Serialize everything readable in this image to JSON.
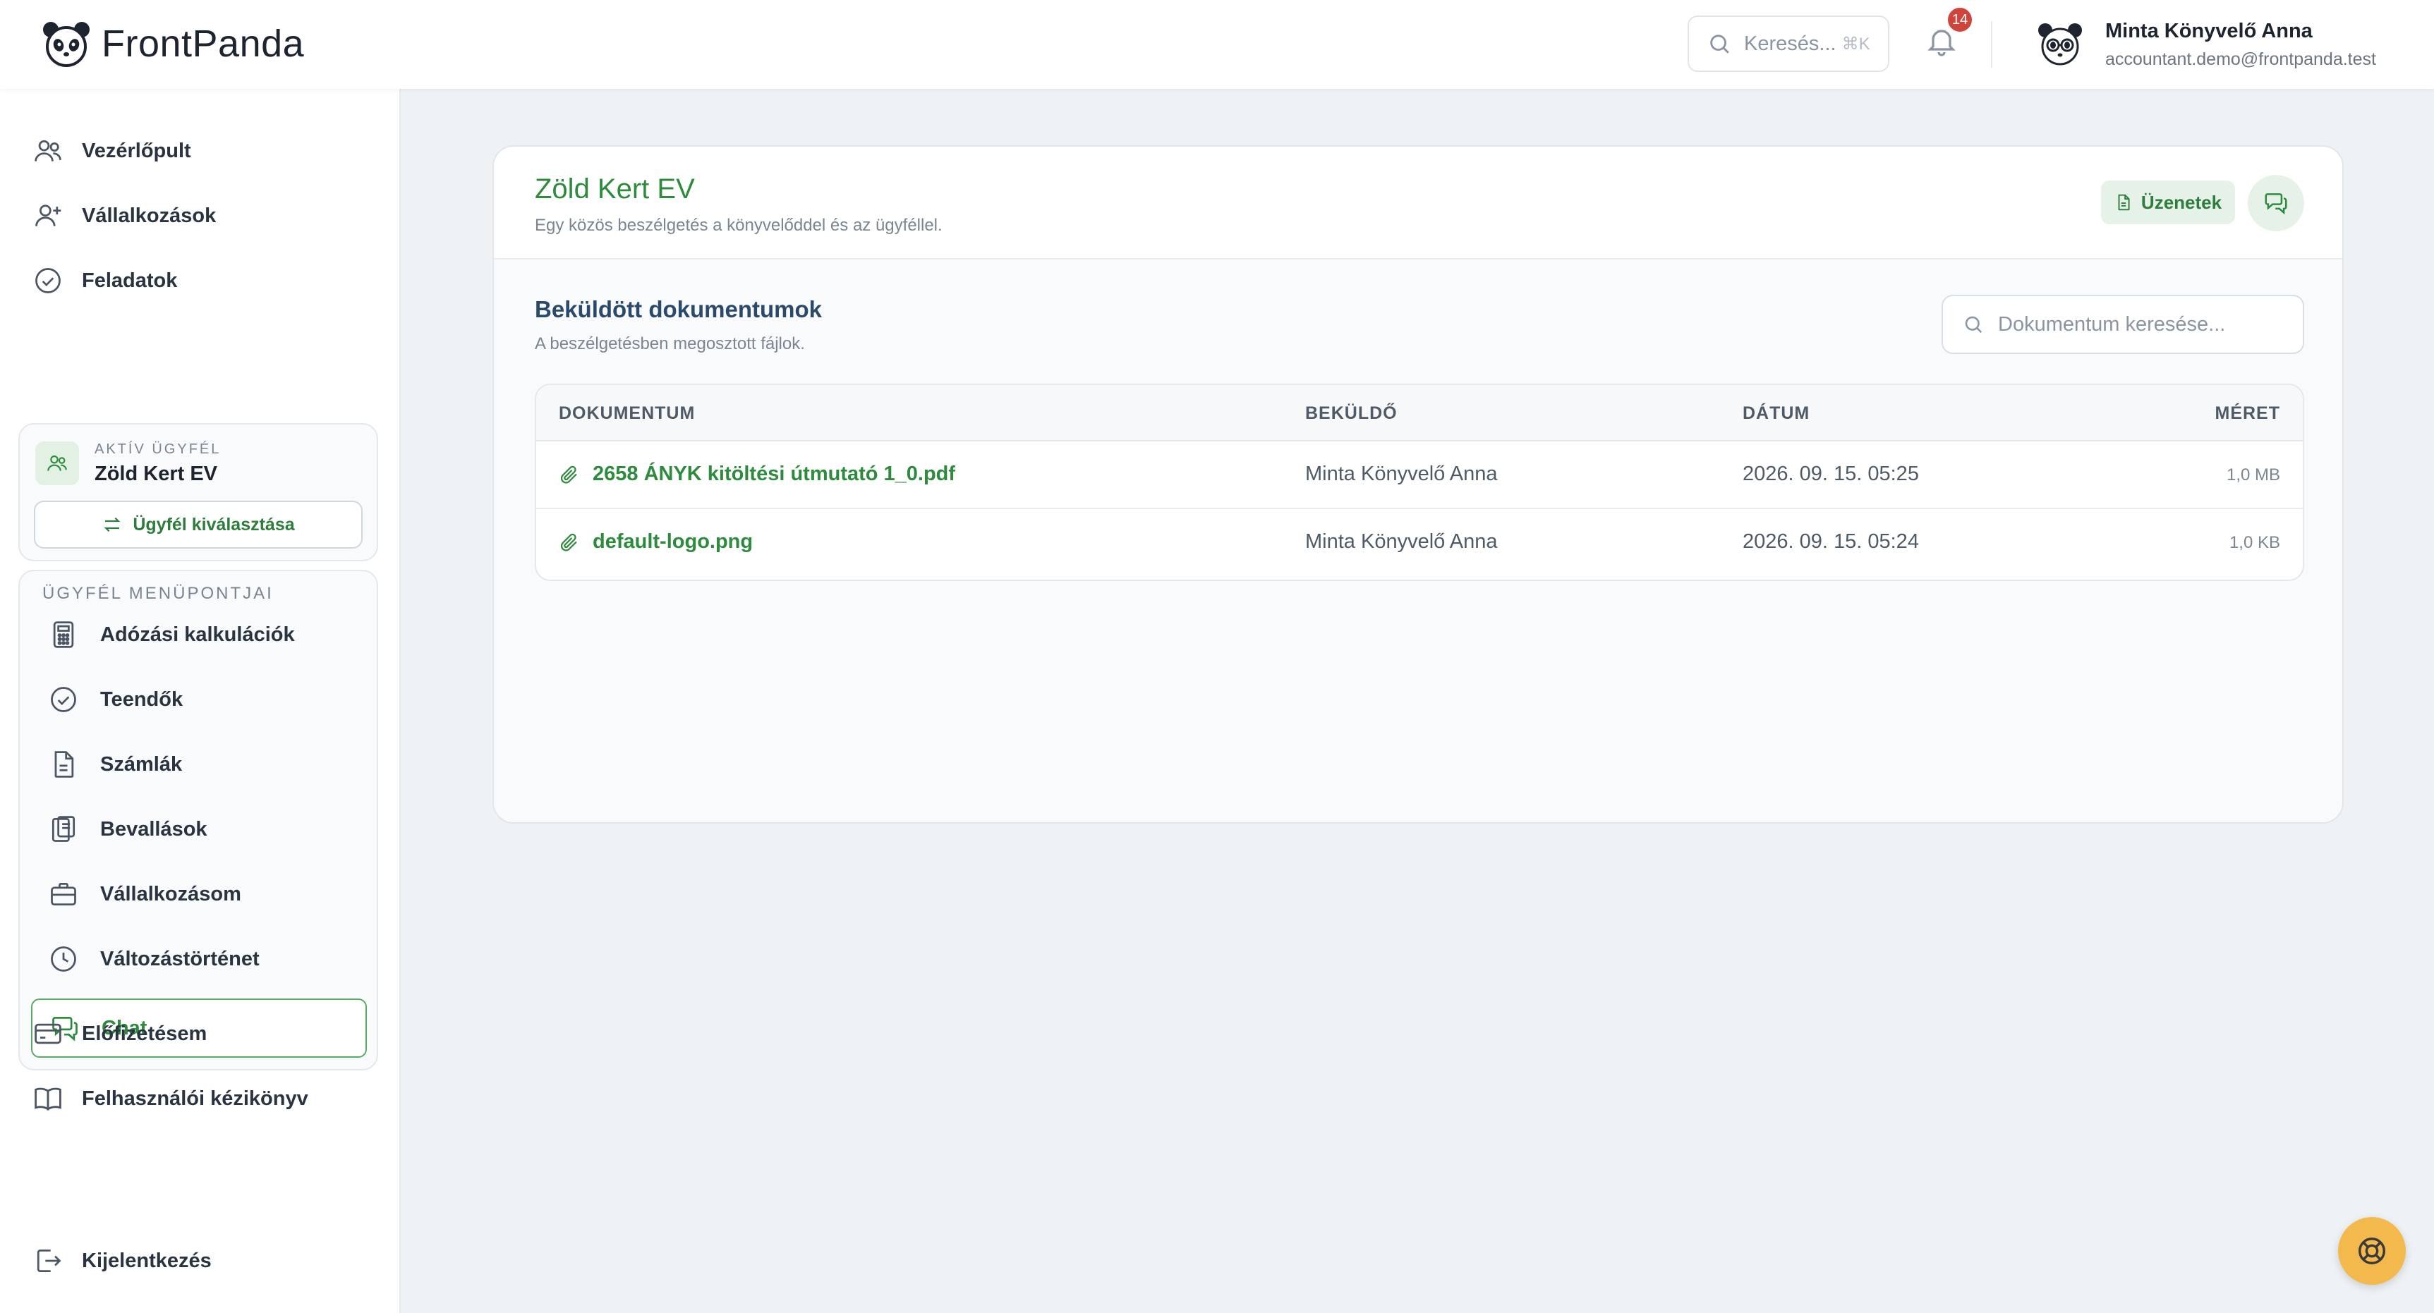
{
  "app": {
    "brand": "FrontPanda",
    "search_placeholder": "Keresés...",
    "search_shortcut": "⌘K",
    "notifications_count": "14",
    "user": {
      "name": "Minta Könyvelő Anna",
      "email": "accountant.demo@frontpanda.test"
    }
  },
  "sidebar": {
    "top_items": [
      {
        "label": "Vezérlőpult",
        "icon": "users-icon"
      },
      {
        "label": "Vállalkozások",
        "icon": "user-plus-icon"
      },
      {
        "label": "Feladatok",
        "icon": "check-circle-icon"
      }
    ],
    "active_client": {
      "label": "AKTÍV ÜGYFÉL",
      "name": "Zöld Kert EV",
      "switch_button": "Ügyfél kiválasztása"
    },
    "client_menu": {
      "label": "ÜGYFÉL MENÜPONTJAI",
      "items": [
        {
          "label": "Adózási kalkulációk",
          "icon": "calculator-icon"
        },
        {
          "label": "Teendők",
          "icon": "check-circle-icon"
        },
        {
          "label": "Számlák",
          "icon": "document-icon"
        },
        {
          "label": "Bevallások",
          "icon": "clipboard-icon"
        },
        {
          "label": "Vállalkozásom",
          "icon": "briefcase-icon"
        },
        {
          "label": "Változástörténet",
          "icon": "clock-icon"
        },
        {
          "label": "Chat",
          "icon": "chat-icon",
          "active": true
        }
      ]
    },
    "bottom_items": [
      {
        "label": "Előfizetésem",
        "icon": "credit-card-icon"
      },
      {
        "label": "Felhasználói kézikönyv",
        "icon": "book-icon"
      }
    ],
    "logout": "Kijelentkezés"
  },
  "main": {
    "title": "Zöld Kert EV",
    "subtitle": "Egy közös beszélgetés a könyvelőddel és az ügyféllel.",
    "messages_button": "Üzenetek",
    "documents": {
      "title": "Beküldött dokumentumok",
      "subtitle": "A beszélgetésben megosztott fájlok.",
      "search_placeholder": "Dokumentum keresése...",
      "columns": [
        "DOKUMENTUM",
        "BEKÜLDŐ",
        "DÁTUM",
        "MÉRET"
      ],
      "rows": [
        {
          "name": "2658 ÁNYK kitöltési útmutató 1_0.pdf",
          "sender": "Minta Könyvelő Anna",
          "date": "2026. 09. 15. 05:25",
          "size": "1,0 MB"
        },
        {
          "name": "default-logo.png",
          "sender": "Minta Könyvelő Anna",
          "date": "2026. 09. 15. 05:24",
          "size": "1,0 KB"
        }
      ]
    }
  },
  "colors": {
    "accent_green": "#2e8b3d",
    "background": "#eef2f5",
    "badge_red": "#d0453b",
    "help_yellow": "#f3b94c"
  }
}
